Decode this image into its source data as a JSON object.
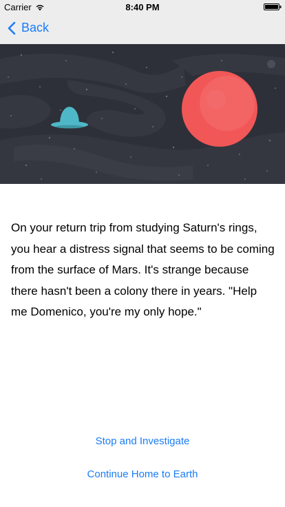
{
  "status_bar": {
    "carrier": "Carrier",
    "time": "8:40 PM",
    "wifi_icon": "wifi-icon",
    "battery_icon": "battery-icon"
  },
  "nav_bar": {
    "back_label": "Back",
    "back_icon": "chevron-left-icon",
    "tint_color": "#1a7cf6"
  },
  "hero": {
    "background_color": "#2d3038",
    "planet_color": "#f25757",
    "ufo_color": "#4fb8c8"
  },
  "story": {
    "text": "On your return trip from studying Saturn's rings, you hear a distress signal that seems to be coming from the surface of Mars. It's strange because there hasn't been a colony there in years. \"Help me Domenico, you're my only hope.\""
  },
  "choices": [
    {
      "label": "Stop and Investigate"
    },
    {
      "label": "Continue Home to Earth"
    }
  ]
}
